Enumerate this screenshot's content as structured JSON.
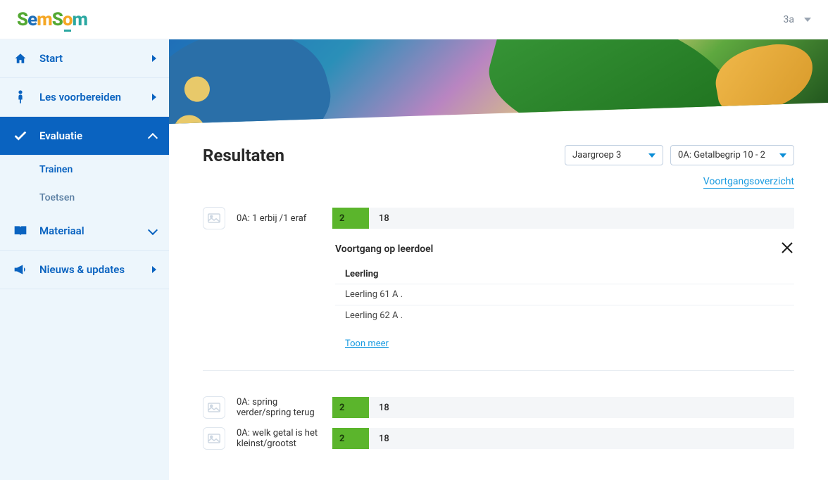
{
  "topbar": {
    "class_label": "3a"
  },
  "sidebar": {
    "items": [
      {
        "label": "Start"
      },
      {
        "label": "Les voorbereiden"
      },
      {
        "label": "Evaluatie",
        "sub": [
          {
            "label": "Trainen"
          },
          {
            "label": "Toetsen"
          }
        ]
      },
      {
        "label": "Materiaal"
      },
      {
        "label": "Nieuws & updates"
      }
    ]
  },
  "page": {
    "title": "Resultaten",
    "select_year": "Jaargroep 3",
    "select_goal": "0A: Getalbegrip 10 - 2",
    "progress_link": "Voortgangsoverzicht"
  },
  "goals": [
    {
      "label": "0A: 1 erbij /1 eraf",
      "green": "2",
      "rest": "18"
    },
    {
      "label": "0A: spring verder/spring terug",
      "green": "2",
      "rest": "18"
    },
    {
      "label": "0A: welk getal is het kleinst/grootst",
      "green": "2",
      "rest": "18"
    }
  ],
  "detail": {
    "title": "Voortgang op leerdoel",
    "col_head": "Leerling",
    "rows": [
      "Leerling 61 A .",
      "Leerling 62 A ."
    ],
    "show_more": "Toon meer"
  }
}
